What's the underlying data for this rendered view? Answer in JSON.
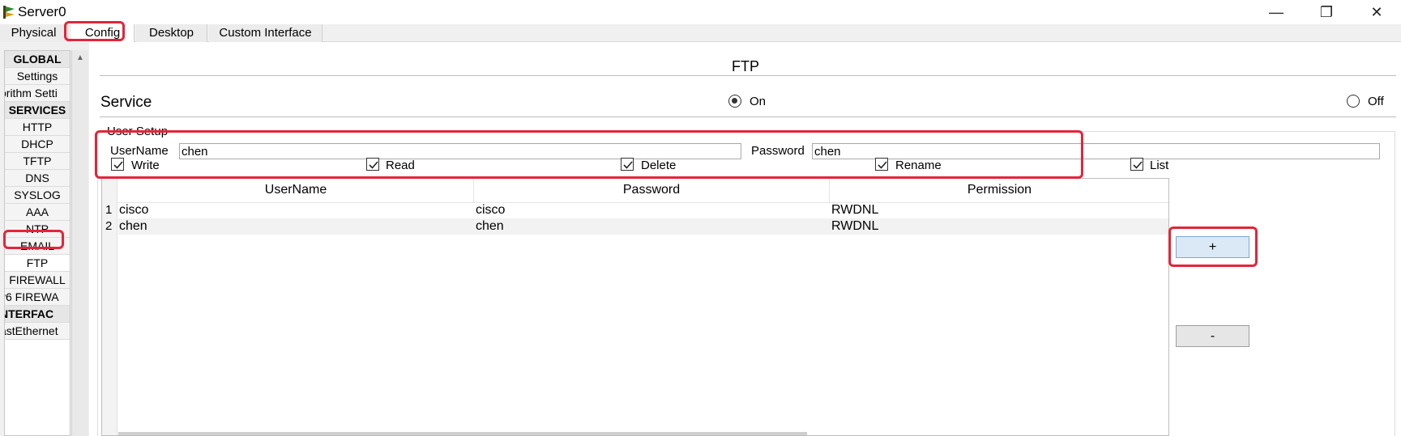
{
  "window": {
    "title": "Server0",
    "controls": {
      "minimize": "—",
      "maximize": "❐",
      "close": "✕"
    }
  },
  "tabs": [
    {
      "label": "Physical"
    },
    {
      "label": "Config",
      "active": true
    },
    {
      "label": "Desktop"
    },
    {
      "label": "Custom Interface"
    }
  ],
  "sidebar": {
    "items": [
      {
        "label": "GLOBAL",
        "header": true
      },
      {
        "label": "Settings"
      },
      {
        "label": "orithm Setti"
      },
      {
        "label": "SERVICES",
        "header": true
      },
      {
        "label": "HTTP"
      },
      {
        "label": "DHCP"
      },
      {
        "label": "TFTP"
      },
      {
        "label": "DNS"
      },
      {
        "label": "SYSLOG"
      },
      {
        "label": "AAA"
      },
      {
        "label": "NTP"
      },
      {
        "label": "EMAIL"
      },
      {
        "label": "FTP",
        "selected": true
      },
      {
        "label": "FIREWALL"
      },
      {
        "label": "v6 FIREWA"
      },
      {
        "label": "NTERFAC",
        "header": true
      },
      {
        "label": "astEthernet"
      }
    ]
  },
  "ftp": {
    "title": "FTP",
    "service": {
      "label": "Service",
      "on_label": "On",
      "off_label": "Off",
      "selected": "On"
    },
    "user_setup": {
      "legend": "User Setup",
      "username_label": "UserName",
      "username_value": "chen",
      "password_label": "Password",
      "password_value": "chen",
      "permissions": [
        {
          "label": "Write",
          "checked": true
        },
        {
          "label": "Read",
          "checked": true
        },
        {
          "label": "Delete",
          "checked": true
        },
        {
          "label": "Rename",
          "checked": true
        },
        {
          "label": "List",
          "checked": true
        }
      ]
    },
    "table": {
      "columns": [
        "UserName",
        "Password",
        "Permission"
      ],
      "rows": [
        {
          "num": "1",
          "username": "cisco",
          "password": "cisco",
          "permission": "RWDNL"
        },
        {
          "num": "2",
          "username": "chen",
          "password": "chen",
          "permission": "RWDNL"
        }
      ]
    },
    "add_button": "+",
    "remove_button": "-"
  },
  "colors": {
    "highlight": "#e3253a",
    "add_button_bg": "#dbe9f7"
  }
}
